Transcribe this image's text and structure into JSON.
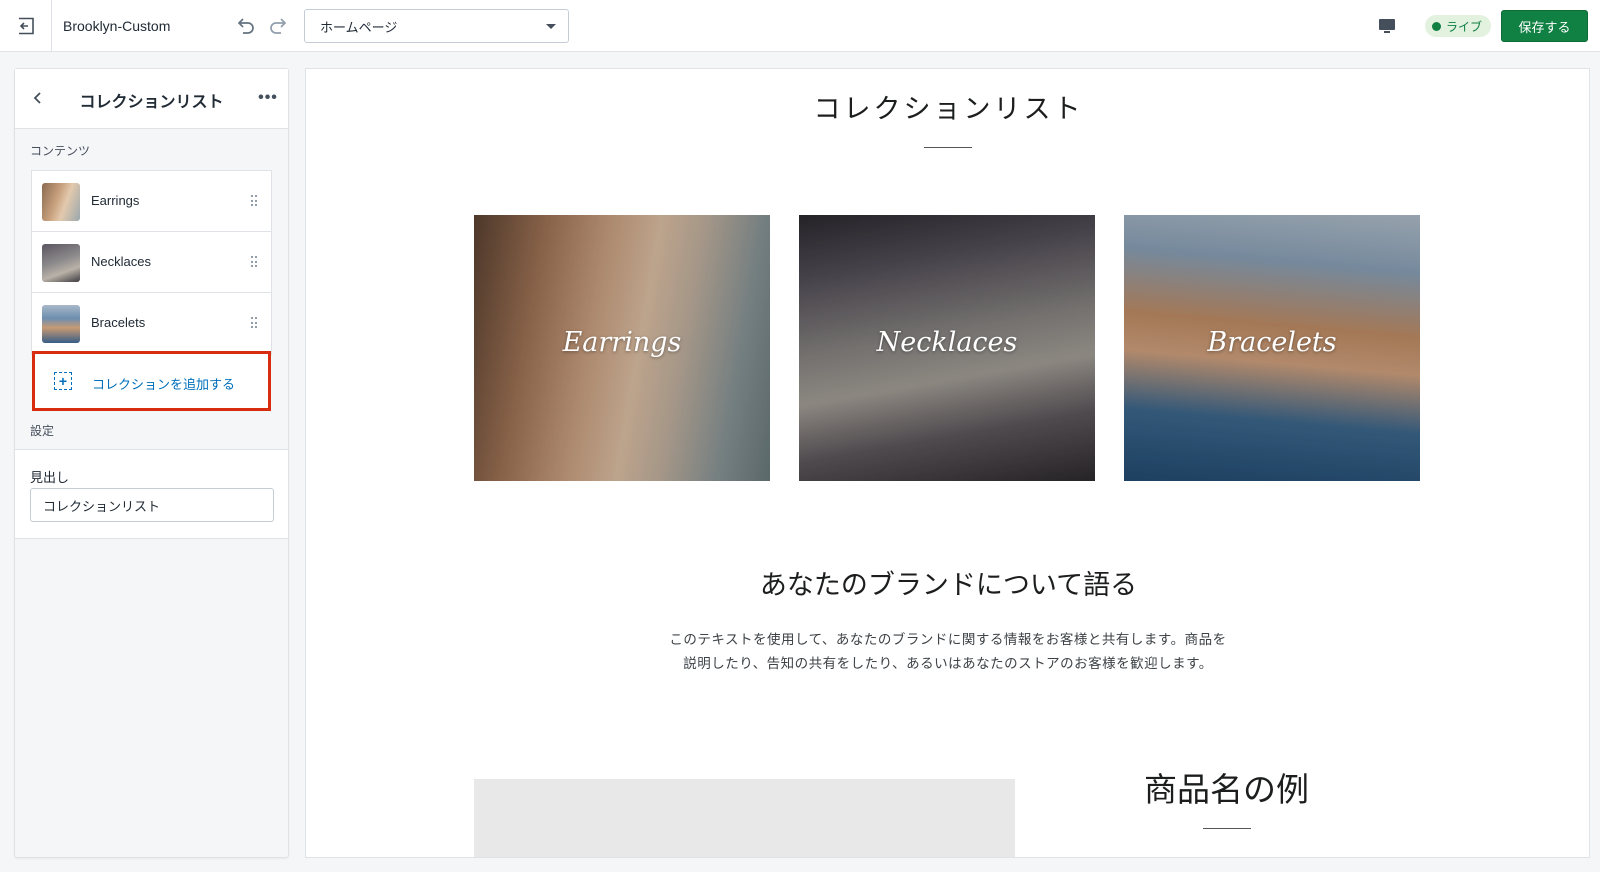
{
  "topbar": {
    "theme_name": "Brooklyn-Custom",
    "page_select_value": "ホームページ",
    "live_label": "ライブ",
    "save_label": "保存する"
  },
  "sidebar": {
    "title": "コレクションリスト",
    "content_label": "コンテンツ",
    "blocks": [
      {
        "label": "Earrings"
      },
      {
        "label": "Necklaces"
      },
      {
        "label": "Bracelets"
      }
    ],
    "add_collection_label": "コレクションを追加する",
    "settings_label": "設定",
    "heading_field_label": "見出し",
    "heading_field_value": "コレクションリスト"
  },
  "preview": {
    "heading": "コレクションリスト",
    "collections": [
      {
        "label": "Earrings"
      },
      {
        "label": "Necklaces"
      },
      {
        "label": "Bracelets"
      }
    ],
    "brand_title": "あなたのブランドについて語る",
    "brand_text_line1": "このテキストを使用して、あなたのブランドに関する情報をお客様と共有します。商品を",
    "brand_text_line2": "説明したり、告知の共有をしたり、あるいはあなたのストアのお客様を歓迎します。",
    "product_name": "商品名の例"
  },
  "colors": {
    "accent_green": "#108043",
    "link_blue": "#006fbb",
    "highlight_red": "#d72c0d"
  }
}
